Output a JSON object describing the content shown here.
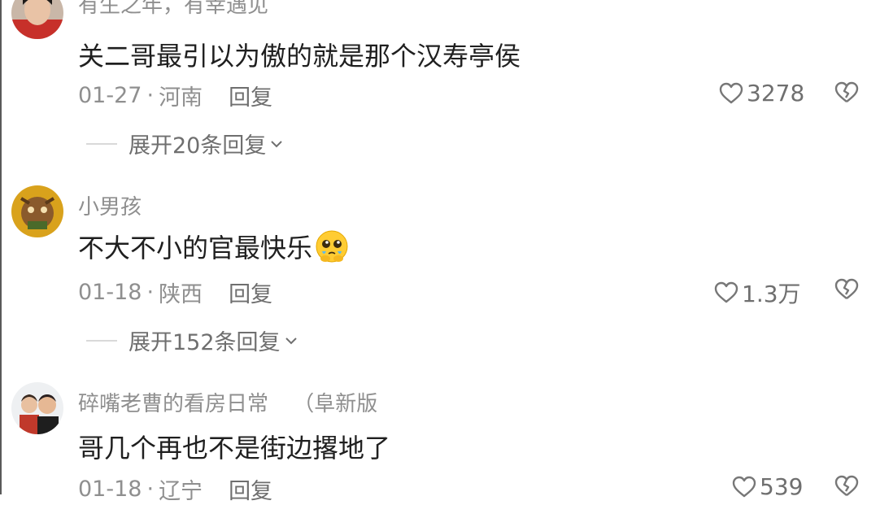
{
  "comments": [
    {
      "username": "有生之年，有幸遇见",
      "content": "关二哥最引以为傲的就是那个汉寿亭侯",
      "date": "01-27",
      "location": "河南",
      "reply_label": "回复",
      "likes": "3278",
      "expand_label": "展开20条回复"
    },
    {
      "username": "小男孩",
      "content": "不大不小的官最快乐",
      "emoji": "crying-pleading-emoji",
      "date": "01-18",
      "location": "陕西",
      "reply_label": "回复",
      "likes": "1.3万",
      "expand_label": "展开152条回复"
    },
    {
      "username": "碎嘴老曹的看房日常",
      "username_tag": "（阜新版",
      "content": "哥几个再也不是街边撂地了",
      "date": "01-18",
      "location": "辽宁",
      "reply_label": "回复",
      "likes": "539"
    }
  ],
  "separator": "·"
}
